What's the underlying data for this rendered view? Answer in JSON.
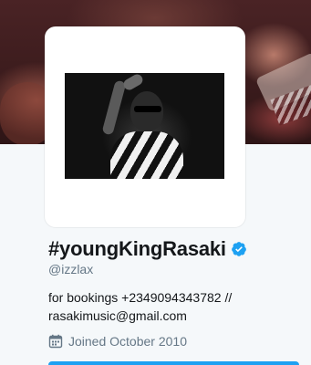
{
  "profile": {
    "display_name": "#youngKingRasaki",
    "handle": "@izzlax",
    "bio_line1": "for bookings +2349094343782 //",
    "bio_line2": "rasakimusic@gmail.com",
    "joined": "Joined October 2010",
    "verified": true
  },
  "icons": {
    "verified": "verified-badge-icon",
    "calendar": "calendar-icon"
  },
  "colors": {
    "accent": "#1da1f2",
    "text_primary": "#14171a",
    "text_secondary": "#657786",
    "background": "#f5f8fa"
  }
}
